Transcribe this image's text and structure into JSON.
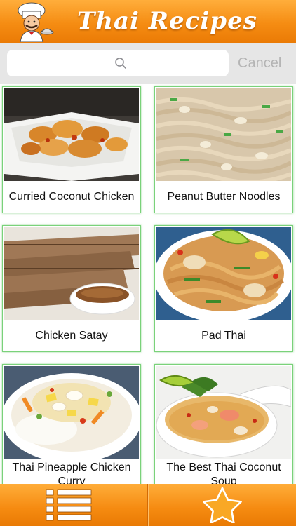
{
  "header": {
    "title": "Thai Recipes",
    "logo_icon": "chef-icon"
  },
  "search": {
    "placeholder": "",
    "value": "",
    "cancel_label": "Cancel"
  },
  "recipes": [
    {
      "title": "Curried Coconut Chicken"
    },
    {
      "title": "Peanut Butter Noodles"
    },
    {
      "title": "Chicken Satay"
    },
    {
      "title": "Pad Thai"
    },
    {
      "title": "Thai Pineapple Chicken Curry"
    },
    {
      "title": "The Best Thai Coconut Soup"
    }
  ],
  "tabbar": {
    "list_icon": "list-icon",
    "favorites_icon": "star-icon"
  },
  "colors": {
    "brand_orange": "#f58c12",
    "card_border": "#7ad27a",
    "search_bg": "#e6e6e6",
    "cancel_text": "#b4b4b4"
  }
}
